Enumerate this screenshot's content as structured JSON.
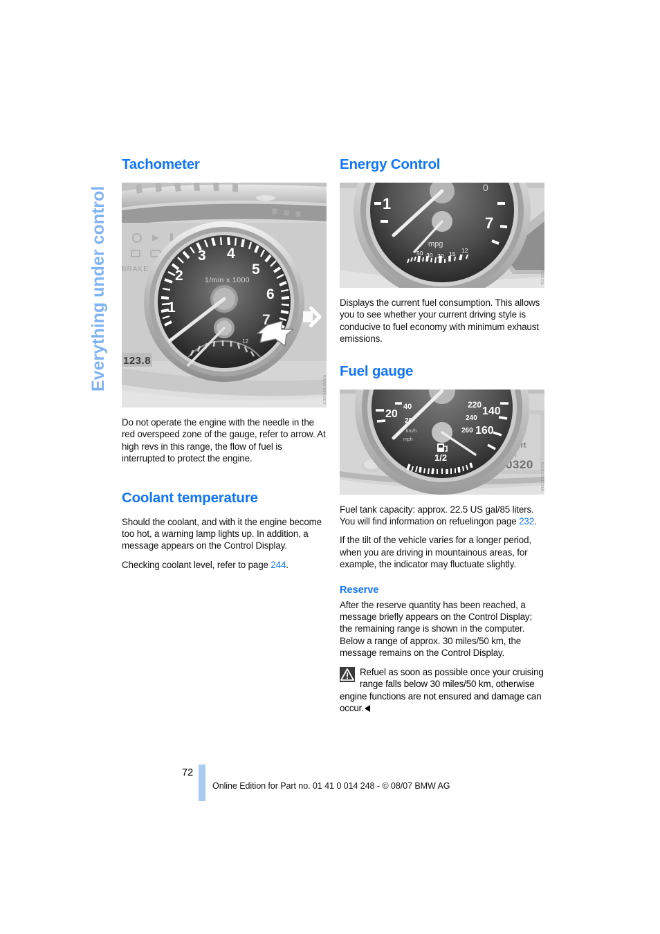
{
  "page": {
    "chapter_tab": "Everything under control",
    "page_number": "72",
    "footer_text": "Online Edition for Part no. 01 41 0 014 248 - © 08/07 BMW AG"
  },
  "left_column": {
    "tachometer": {
      "title": "Tachometer",
      "figure": {
        "alt_name": "tachometer-instrument-cluster-photo",
        "watermark": "WWW.IMAGES",
        "dial_label": "1/min x 1000",
        "dial_numbers": [
          "1",
          "2",
          "3",
          "4",
          "5",
          "6",
          "7"
        ],
        "odometer_display": "123.8",
        "callout": "arrow-pointing-to-red-zone"
      },
      "body": "Do not operate the engine with the needle in the red overspeed zone of the gauge, refer to arrow. At high revs in this range, the flow of fuel is interrupted to protect the engine."
    },
    "coolant": {
      "title": "Coolant temperature",
      "body": "Should the coolant, and with it the engine become too hot, a warning lamp lights up. In addition, a message appears on the Control Display.",
      "ref_prefix": "Checking coolant level, refer to page ",
      "ref_page": "244",
      "ref_suffix": "."
    }
  },
  "right_column": {
    "energy_control": {
      "title": "Energy Control",
      "figure": {
        "alt_name": "energy-control-gauge-photo",
        "watermark": "WCB8100CM",
        "dial_label": "mpg",
        "dial_numbers": [
          "50",
          "30",
          "20",
          "15",
          "12"
        ],
        "tach_numbers": [
          "1",
          "7"
        ]
      },
      "body": "Displays the current fuel consumption. This allows you to see whether your current driving style is conducive to fuel economy with minimum exhaust emissions."
    },
    "fuel_gauge": {
      "title": "Fuel gauge",
      "figure": {
        "alt_name": "fuel-gauge-photo",
        "watermark": "WCB1001CMA",
        "fuel_label": "1/2",
        "speed_numbers": [
          "20",
          "40",
          "220",
          "240",
          "260",
          "140",
          "160"
        ],
        "display_mode": "sport",
        "display_value": "0320"
      },
      "capacity_line1": "Fuel tank capacity: approx. 22.5 US gal/",
      "capacity_line2": "85 liters. You will find information on refueling",
      "capacity_line3_prefix": "on page ",
      "capacity_ref_page": "232",
      "capacity_line3_suffix": ".",
      "tilt_body": "If the tilt of the vehicle varies for a longer period, when you are driving in mountainous areas, for example, the indicator may fluctuate slightly."
    },
    "reserve": {
      "title": "Reserve",
      "body": "After the reserve quantity has been reached, a message briefly appears on the Control Display; the remaining range is shown in the computer. Below a range of approx. 30 miles/50 km, the message remains on the Control Display.",
      "warning": "Refuel as soon as possible once your cruising range falls below 30 miles/50 km, otherwise engine functions are not ensured and damage can occur."
    }
  },
  "colors": {
    "heading_blue": "#1175F5",
    "tab_blue": "#7FB3F2",
    "footer_bar_blue": "#A9CCF2"
  }
}
